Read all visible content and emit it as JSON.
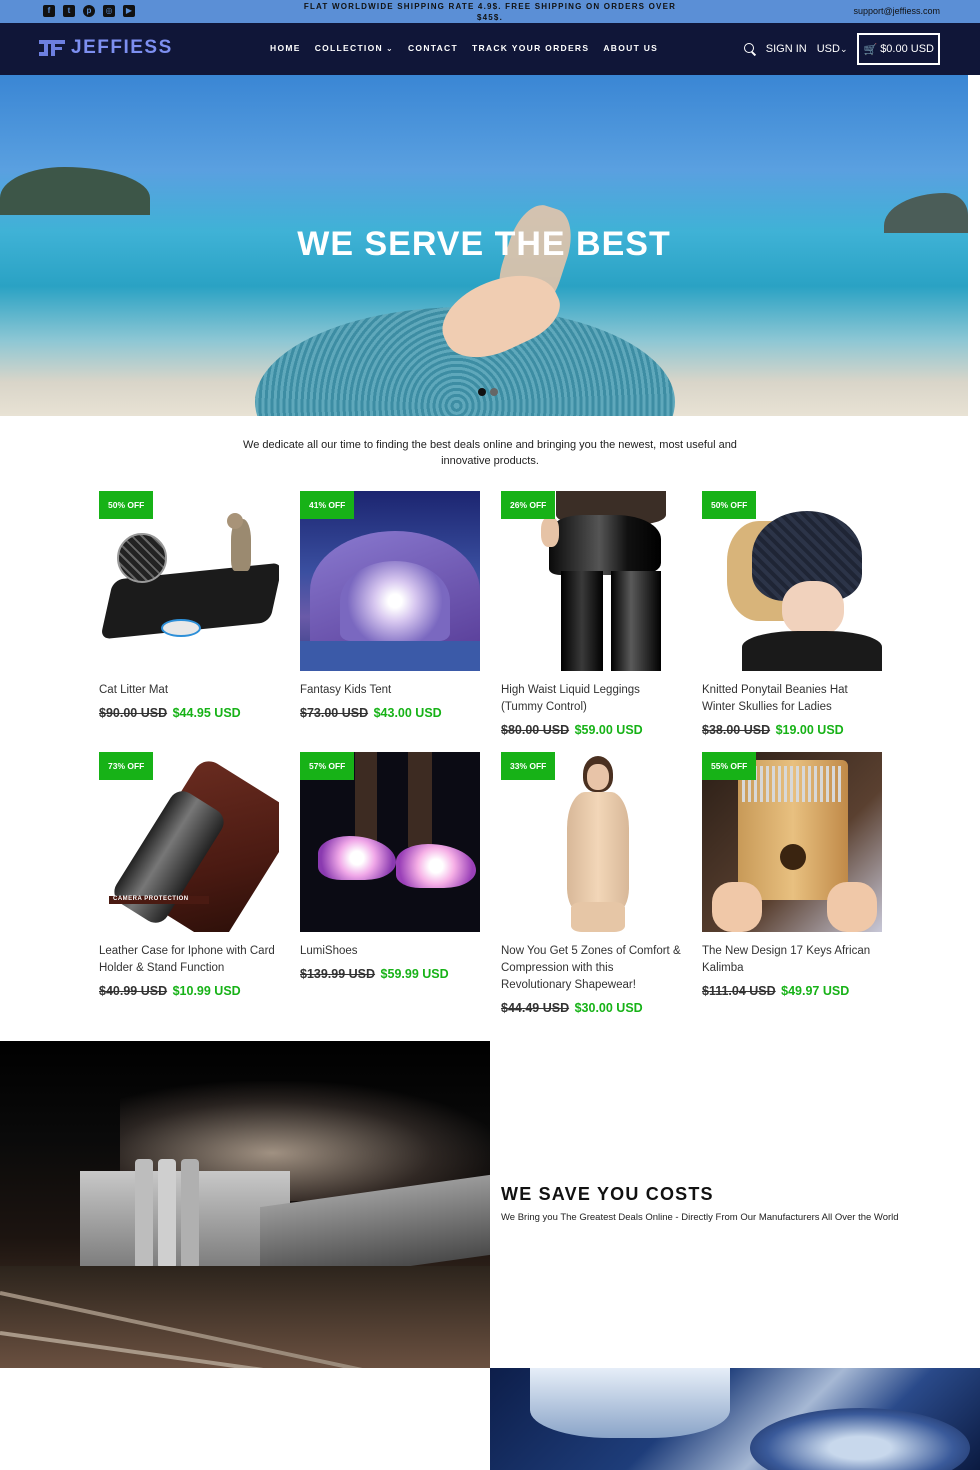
{
  "announcement": {
    "text": "FLAT WORLDWIDE SHIPPING RATE 4.9$. FREE SHIPPING ON ORDERS OVER $45$.",
    "email": "support@jeffiess.com",
    "social": [
      "facebook-icon",
      "twitter-icon",
      "pinterest-icon",
      "instagram-icon",
      "youtube-icon"
    ]
  },
  "header": {
    "brand": "JEFFIESS",
    "nav": [
      "HOME",
      "COLLECTION",
      "CONTACT",
      "TRACK YOUR ORDERS",
      "ABOUT US"
    ],
    "sign_in": "SIGN IN",
    "currency": "USD",
    "cart": "$0.00 USD"
  },
  "hero": {
    "title": "WE SERVE THE BEST"
  },
  "intro": "We dedicate all our time to finding the best deals online and bringing you the newest, most useful and innovative products.",
  "products": [
    {
      "badge": "50% OFF",
      "title": "Cat Litter Mat",
      "old_price": "$90.00 USD",
      "new_price": "$44.95 USD"
    },
    {
      "badge": "41% OFF",
      "title": "Fantasy Kids Tent",
      "old_price": "$73.00 USD",
      "new_price": "$43.00 USD"
    },
    {
      "badge": "26% OFF",
      "title": "High Waist Liquid Leggings (Tummy Control)",
      "old_price": "$80.00 USD",
      "new_price": "$59.00 USD"
    },
    {
      "badge": "50% OFF",
      "title": "Knitted Ponytail Beanies Hat Winter Skullies for Ladies",
      "old_price": "$38.00 USD",
      "new_price": "$19.00 USD"
    },
    {
      "badge": "73% OFF",
      "title": "Leather Case for Iphone with Card Holder & Stand Function",
      "old_price": "$40.99 USD",
      "new_price": "$10.99 USD",
      "img_label": "CAMERA PROTECTION"
    },
    {
      "badge": "57% OFF",
      "title": "LumiShoes",
      "old_price": "$139.99 USD",
      "new_price": "$59.99 USD"
    },
    {
      "badge": "33% OFF",
      "title": "Now You Get 5 Zones of Comfort & Compression with this Revolutionary Shapewear!",
      "old_price": "$44.49 USD",
      "new_price": "$30.00 USD"
    },
    {
      "badge": "55% OFF",
      "title": "The New Design 17 Keys African Kalimba",
      "old_price": "$111.04 USD",
      "new_price": "$49.97 USD"
    }
  ],
  "feature": {
    "title": "WE SAVE YOU COSTS",
    "subtitle": "We Bring you The Greatest Deals Online - Directly From Our Manufacturers All Over the World"
  },
  "colors": {
    "announcement_bg": "#5b8fd6",
    "header_bg": "#101638",
    "badge": "#17b217",
    "sale_price": "#17b217"
  }
}
